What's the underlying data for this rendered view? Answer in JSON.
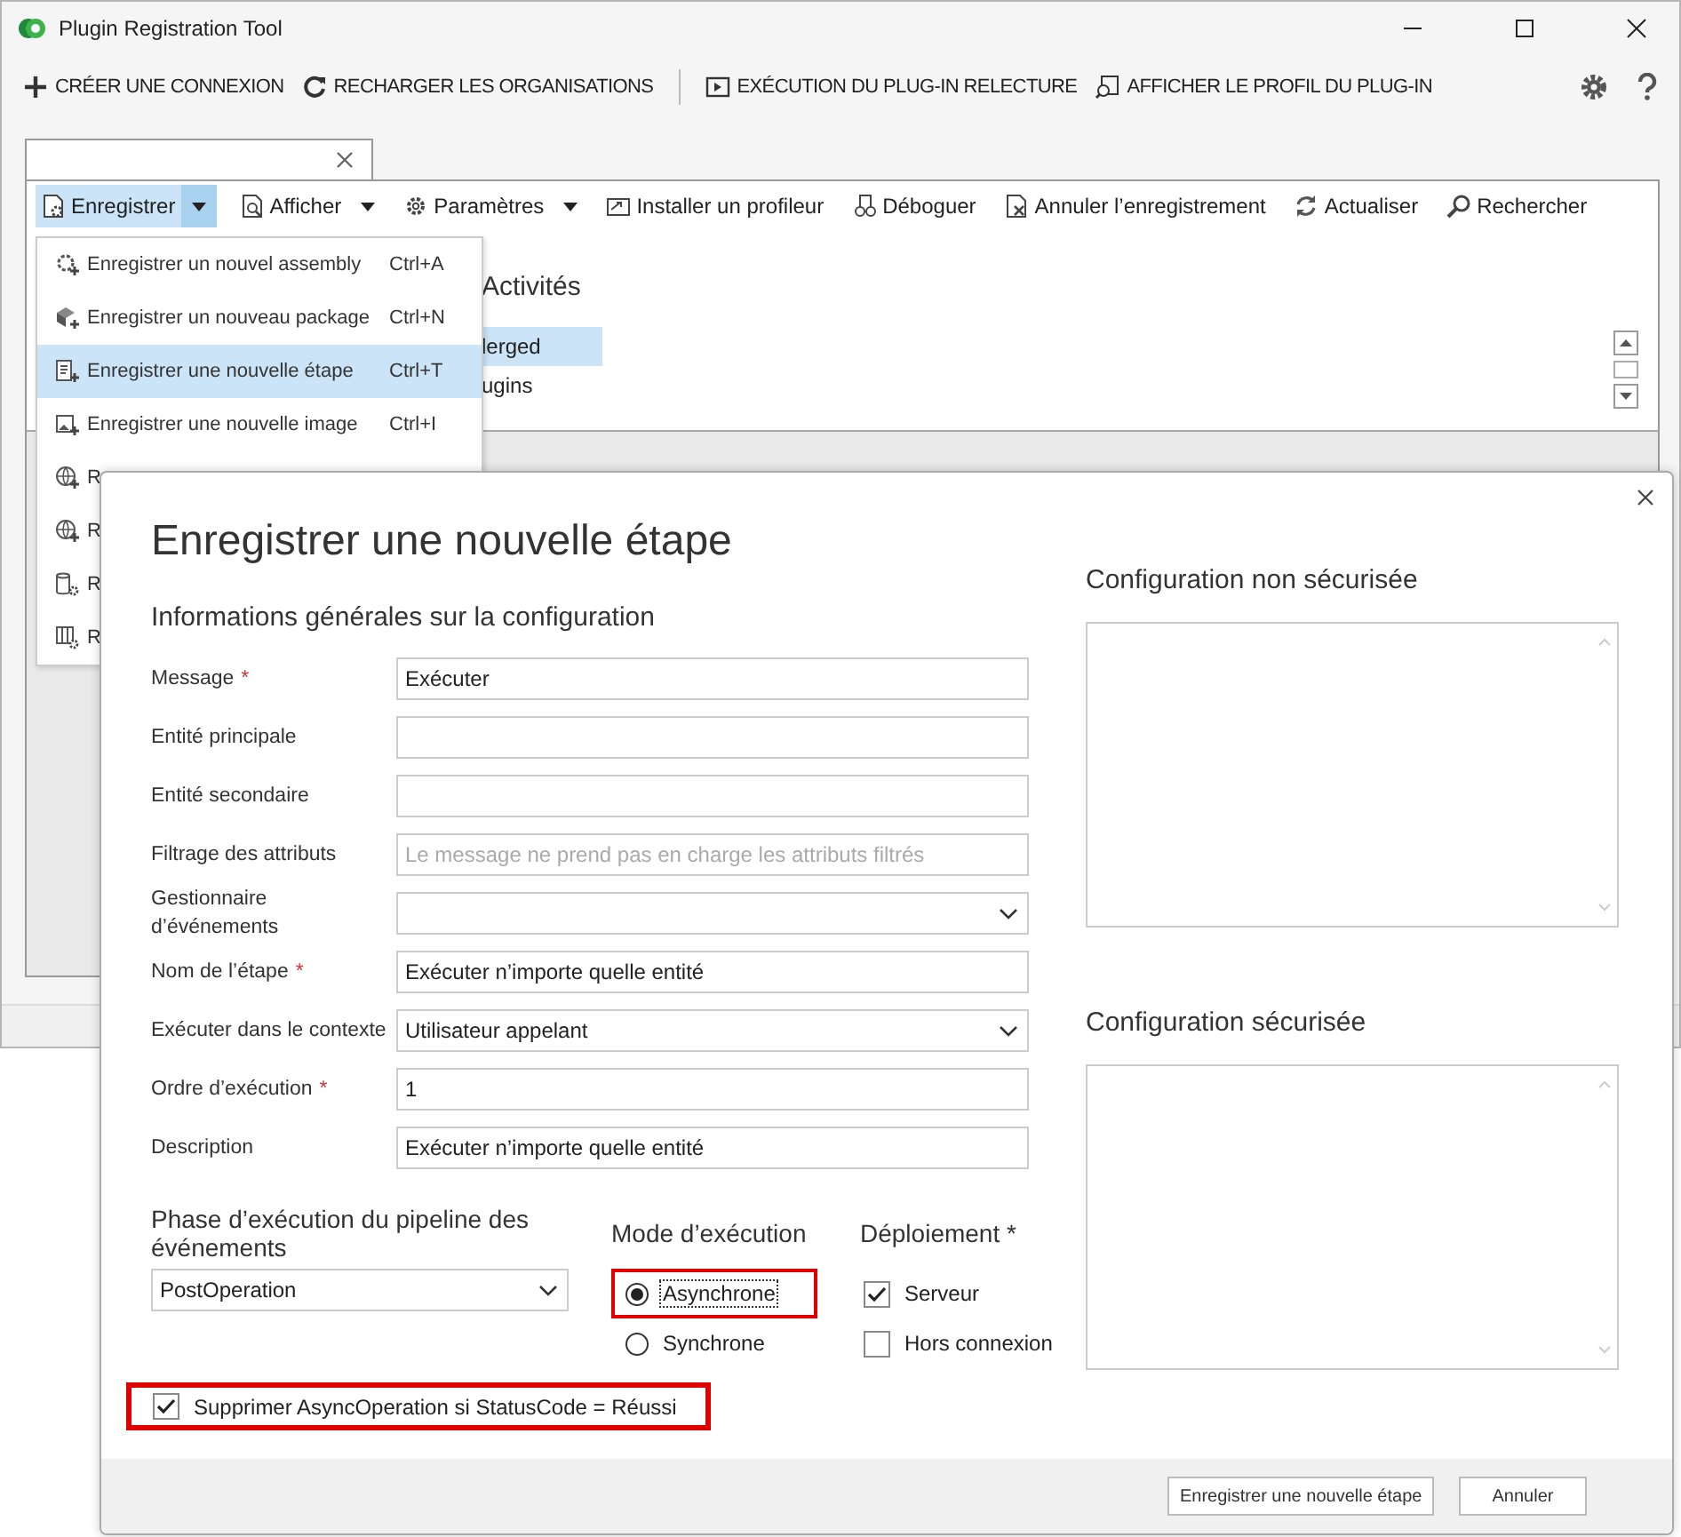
{
  "window": {
    "title": "Plugin Registration Tool"
  },
  "toolbar": {
    "items": [
      {
        "label": "CRÉER UNE CONNEXION"
      },
      {
        "label": "RECHARGER LES ORGANISATIONS"
      },
      {
        "label": "EXÉCUTION DU PLUG-IN RELECTURE"
      },
      {
        "label": "AFFICHER LE PROFIL DU PLUG-IN"
      }
    ]
  },
  "command_bar": [
    {
      "label": "Enregistrer",
      "kind": "split",
      "open": true
    },
    {
      "label": "Afficher",
      "kind": "dropdown",
      "open": false
    },
    {
      "label": "Paramètres",
      "kind": "dropdown",
      "open": false
    },
    {
      "label": "Installer un profileur",
      "kind": "button"
    },
    {
      "label": "Déboguer",
      "kind": "button"
    },
    {
      "label": "Annuler l’enregistrement",
      "kind": "button"
    },
    {
      "label": "Actualiser",
      "kind": "button"
    },
    {
      "label": "Rechercher",
      "kind": "button"
    }
  ],
  "menu": {
    "items": [
      {
        "label": "Enregistrer un nouvel assembly",
        "shortcut": "Ctrl+A",
        "selected": false
      },
      {
        "label": "Enregistrer un nouveau package",
        "shortcut": "Ctrl+N",
        "selected": false
      },
      {
        "label": "Enregistrer une nouvelle étape",
        "shortcut": "Ctrl+T",
        "selected": true
      },
      {
        "label": "Enregistrer une nouvelle image",
        "shortcut": "Ctrl+I",
        "selected": false
      },
      {
        "label": "R",
        "selected": false
      },
      {
        "label": "R",
        "selected": false
      },
      {
        "label": "R",
        "selected": false
      },
      {
        "label": "R",
        "selected": false
      }
    ]
  },
  "tree": {
    "heading": "Activités",
    "items": [
      {
        "label": "lerged",
        "selected": true
      },
      {
        "label": "ugins",
        "selected": false
      }
    ]
  },
  "dialog": {
    "title": "Enregistrer une nouvelle étape",
    "section_title": "Informations générales sur la configuration",
    "fields": [
      {
        "label": "Message",
        "required_mark": "*",
        "kind": "text",
        "value": "Exécuter"
      },
      {
        "label": "Entité principale",
        "kind": "text"
      },
      {
        "label": "Entité secondaire",
        "kind": "text"
      },
      {
        "label": "Filtrage des attributs",
        "kind": "text",
        "placeholder": "Le message ne prend pas en charge les attributs filtrés"
      },
      {
        "label": "Gestionnaire d’événements",
        "kind": "select"
      },
      {
        "label": "Nom de l’étape",
        "required_mark": "*",
        "kind": "text",
        "value": "Exécuter n’importe quelle entité"
      },
      {
        "label": "Exécuter dans le contexte",
        "kind": "select",
        "value": "Utilisateur appelant"
      },
      {
        "label": "Ordre d’exécution",
        "required_mark": "*",
        "kind": "text",
        "value": "1"
      },
      {
        "label": "Description",
        "kind": "text",
        "value": "Exécuter n’importe quelle entité"
      }
    ],
    "pipeline": {
      "title": "Phase d’exécution du pipeline des événements",
      "value": "PostOperation"
    },
    "mode": {
      "title": "Mode d’exécution",
      "options": [
        {
          "label": "Asynchrone",
          "selected": true,
          "focused": true,
          "highlighted": true
        },
        {
          "label": "Synchrone",
          "selected": false,
          "focused": false,
          "highlighted": false
        }
      ]
    },
    "deployment": {
      "title": "Déploiement *",
      "options": [
        {
          "label": "Serveur",
          "checked": true
        },
        {
          "label": "Hors connexion",
          "checked": false
        }
      ]
    },
    "delete_async": {
      "label": "Supprimer AsyncOperation si StatusCode = Réussi",
      "checked": true,
      "highlighted": true
    },
    "unsecure_config": {
      "title": "Configuration non sécurisée"
    },
    "secure_config": {
      "title": "Configuration sécurisée"
    },
    "buttons": [
      "Enregistrer une nouvelle étape",
      "Annuler"
    ]
  }
}
